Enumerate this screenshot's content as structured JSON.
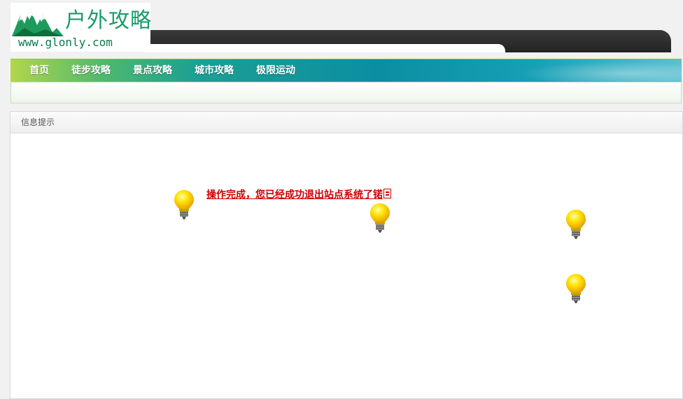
{
  "logo": {
    "title": "户外攻略",
    "url": "www.glonly.com"
  },
  "nav": {
    "items": [
      {
        "label": "首页"
      },
      {
        "label": "徒步攻略"
      },
      {
        "label": "景点攻略"
      },
      {
        "label": "城市攻略"
      },
      {
        "label": "极限运动"
      }
    ]
  },
  "panel": {
    "title": "信息提示",
    "message": "操作完成，您已经成功退出站点系统了锘"
  },
  "icons": {
    "bulb": "lightbulb-icon",
    "logo": "mountain-logo-icon",
    "redirect": "redirect-glyph-icon"
  },
  "colors": {
    "brand_green": "#1a9a6a",
    "message_red": "#cc0000",
    "nav_teal": "#0b8ea2"
  }
}
